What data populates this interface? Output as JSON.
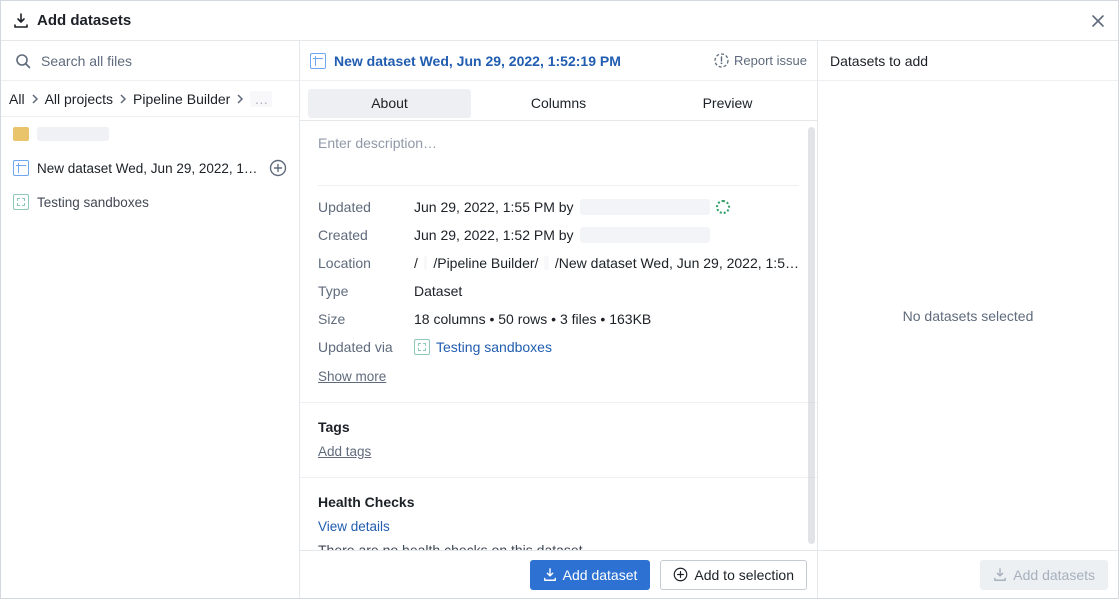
{
  "dialog": {
    "title": "Add datasets"
  },
  "search": {
    "placeholder": "Search all files"
  },
  "breadcrumbs": {
    "all": "All",
    "all_projects": "All projects",
    "pipeline_builder": "Pipeline Builder",
    "overflow": "…"
  },
  "files": {
    "dataset_row": "New dataset Wed, Jun 29, 2022, 1:…",
    "sandbox_row": "Testing sandboxes"
  },
  "header": {
    "dataset_name": "New dataset Wed, Jun 29, 2022, 1:52:19 PM",
    "report_issue": "Report issue"
  },
  "tabs": {
    "about": "About",
    "columns": "Columns",
    "preview": "Preview"
  },
  "about": {
    "description_placeholder": "Enter description…",
    "labels": {
      "updated": "Updated",
      "created": "Created",
      "location": "Location",
      "type": "Type",
      "size": "Size",
      "updated_via": "Updated via"
    },
    "updated_value_prefix": "Jun 29, 2022, 1:55 PM by ",
    "created_value_prefix": "Jun 29, 2022, 1:52 PM by ",
    "location_path_mid": "/Pipeline Builder/",
    "location_path_tail": "/New dataset Wed, Jun 29, 2022, 1:5…",
    "type_value": "Dataset",
    "size_value": "18 columns • 50 rows • 3 files • 163KB",
    "updated_via_value": "Testing sandboxes",
    "show_more": "Show more"
  },
  "tags": {
    "title": "Tags",
    "add_tags": "Add tags"
  },
  "health": {
    "title": "Health Checks",
    "view_details": "View details",
    "empty": "There are no health checks on this dataset."
  },
  "actions": {
    "add_dataset": "Add dataset",
    "add_to_selection": "Add to selection",
    "add_datasets": "Add datasets"
  },
  "right": {
    "title": "Datasets to add",
    "empty": "No datasets selected"
  }
}
